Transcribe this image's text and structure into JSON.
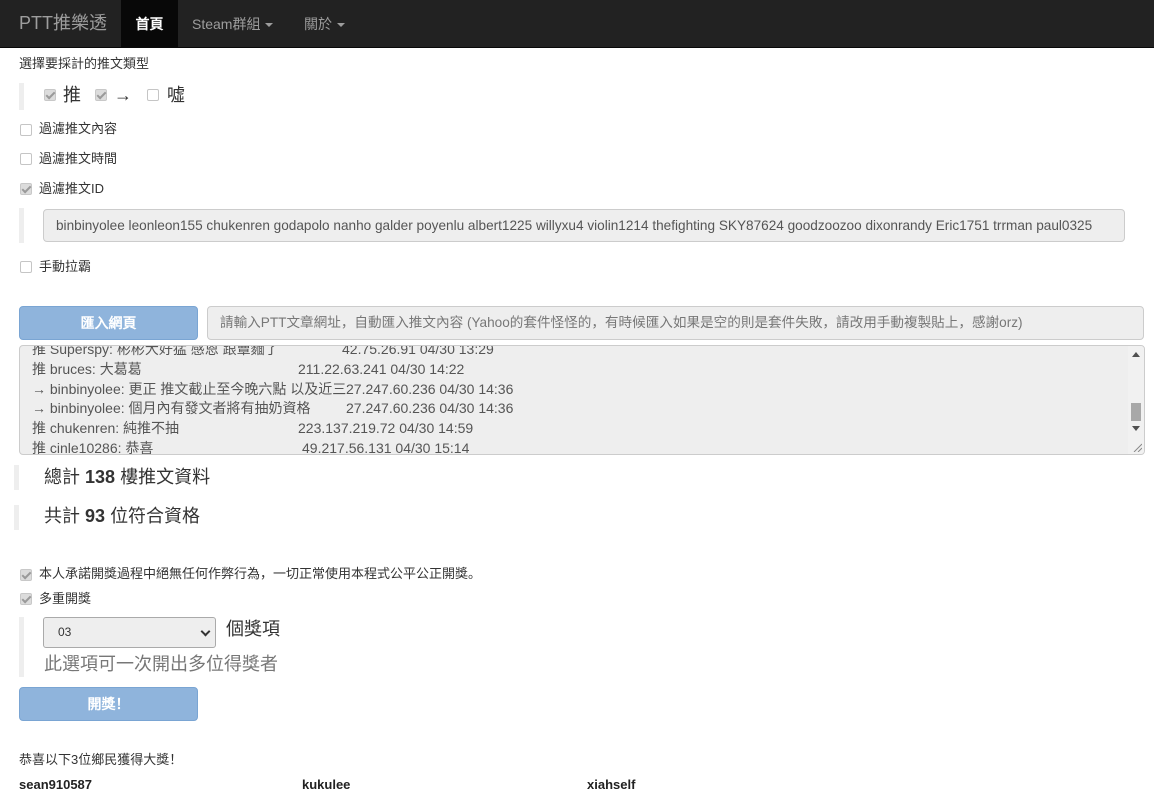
{
  "navbar": {
    "brand": "PTT推樂透",
    "items": [
      {
        "label": "首頁"
      },
      {
        "label": "Steam群組"
      },
      {
        "label": "關於"
      }
    ]
  },
  "push_type": {
    "heading": "選擇要採計的推文類型",
    "options": [
      {
        "label": "推",
        "checked": true
      },
      {
        "label": "→",
        "checked": true
      },
      {
        "label": "噓",
        "checked": false
      }
    ]
  },
  "filters": {
    "content": {
      "label": "過濾推文內容",
      "checked": false
    },
    "time": {
      "label": "過濾推文時間",
      "checked": false
    },
    "id": {
      "label": "過濾推文ID",
      "checked": true
    },
    "id_value": "binbinyolee leonleon155 chukenren godapolo nanho galder poyenlu albert1225 willyxu4 violin1214 thefighting SKY87624 goodzoozoo dixonrandy Eric1751 trrman paul0325",
    "manual": {
      "label": "手動拉霸",
      "checked": false
    }
  },
  "import": {
    "button_label": "匯入網頁",
    "url_placeholder": "請輸入PTT文章網址，自動匯入推文內容 (Yahoo的套件怪怪的，有時候匯入如果是空的則是套件失敗，請改用手動複製貼上，感謝orz)"
  },
  "comments": [
    {
      "tag": "推",
      "user": "Superspy",
      "text": "彬彬大好猛 感恩 跟蕈麵了",
      "ip": "42.75.26.91",
      "time": "04/30 13:29"
    },
    {
      "tag": "推",
      "user": "bruces",
      "text": "大葛葛",
      "ip": "211.22.63.241",
      "time": "04/30 14:22"
    },
    {
      "tag": "→",
      "user": "binbinyolee",
      "text": "更正 推文截止至今晚六點 以及近三",
      "ip": "27.247.60.236",
      "time": "04/30 14:36"
    },
    {
      "tag": "→",
      "user": "binbinyolee",
      "text": "個月內有發文者將有抽奶資格",
      "ip": "27.247.60.236",
      "time": "04/30 14:36"
    },
    {
      "tag": "推",
      "user": "chukenren",
      "text": "純推不抽",
      "ip": "223.137.219.72",
      "time": "04/30 14:59"
    },
    {
      "tag": "推",
      "user": "cinle10286",
      "text": "恭喜",
      "ip": "49.217.56.131",
      "time": "04/30 15:14"
    }
  ],
  "stats": {
    "total_prefix": "總計",
    "total_count": "138",
    "total_suffix": "樓推文資料",
    "eligible_prefix": "共計",
    "eligible_count": "93",
    "eligible_suffix": "位符合資格"
  },
  "draw": {
    "pledge": {
      "label": "本人承諾開獎過程中絕無任何作弊行為，一切正常使用本程式公平公正開獎。",
      "checked": true
    },
    "multi": {
      "label": "多重開獎",
      "checked": true
    },
    "prize_count": "03",
    "prize_unit": "個獎項",
    "help_text": "此選項可一次開出多位得獎者",
    "button_label": "開獎！"
  },
  "result": {
    "heading": "恭喜以下3位鄉民獲得大獎！",
    "winners": [
      "sean910587",
      "kukulee",
      "xiahself"
    ]
  }
}
